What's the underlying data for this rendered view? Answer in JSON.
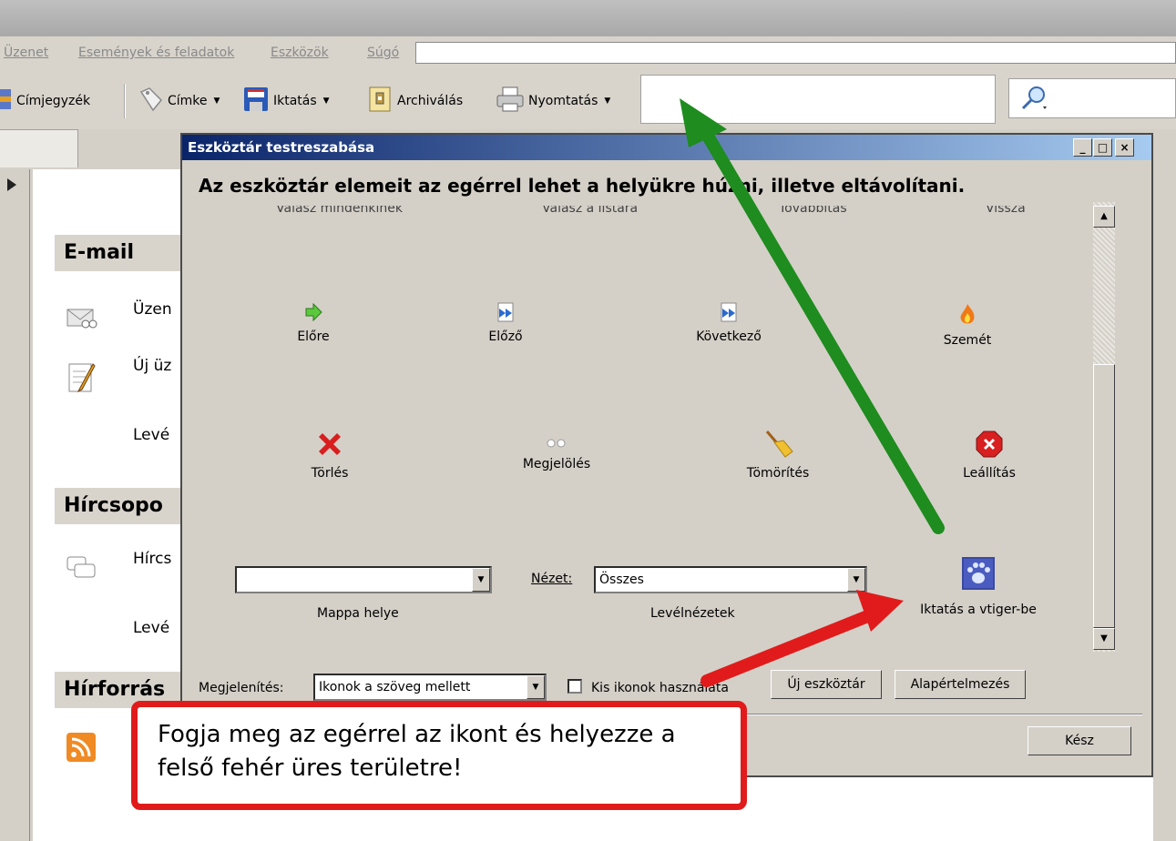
{
  "menubar": {
    "items": [
      "Üzenet",
      "Események és feladatok",
      "Eszközök",
      "Súgó"
    ]
  },
  "toolbar": {
    "buttons": [
      {
        "label": "Címjegyzék",
        "icon": "address-book-icon"
      },
      {
        "label": "Címke",
        "icon": "tag-icon",
        "dropdown": true
      },
      {
        "label": "Iktatás",
        "icon": "save-disk-icon",
        "dropdown": true
      },
      {
        "label": "Archiválás",
        "icon": "archive-icon"
      },
      {
        "label": "Nyomtatás",
        "icon": "printer-icon",
        "dropdown": true
      }
    ],
    "search_icon": "magnifier-icon"
  },
  "sidebar": {
    "sections": [
      {
        "title": "E-mail",
        "rows": [
          "Üzen",
          "Új üz",
          "Levé"
        ]
      },
      {
        "title": "Hírcsopo",
        "rows": [
          "Hírcs",
          "Levé"
        ]
      },
      {
        "title": "Hírforrás",
        "rows": []
      }
    ]
  },
  "dialog": {
    "title": "Eszköztár testreszabása",
    "window_buttons": [
      "_",
      "□",
      "×"
    ],
    "heading": "Az eszköztár elemeit az egérrel lehet a helyükre húzni, illetve eltávolítani.",
    "cut_labels": [
      "Válasz mindenkinek",
      "Válasz a listára",
      "Továbbítás",
      "Vissza"
    ],
    "row1": [
      {
        "label": "Előre",
        "icon": "forward-arrow-icon"
      },
      {
        "label": "Előző",
        "icon": "previous-icon"
      },
      {
        "label": "Következő",
        "icon": "next-icon"
      },
      {
        "label": "Szemét",
        "icon": "junk-flame-icon"
      }
    ],
    "row2": [
      {
        "label": "Törlés",
        "icon": "delete-x-icon"
      },
      {
        "label": "Megjelölés",
        "icon": "mark-icon"
      },
      {
        "label": "Tömörítés",
        "icon": "compact-broom-icon"
      },
      {
        "label": "Leállítás",
        "icon": "stop-icon"
      }
    ],
    "folder_location_label": "Mappa helye",
    "view_label": "Nézet:",
    "view_value": "Összes",
    "view_caption": "Levélnézetek",
    "vtiger_label": "Iktatás a vtiger-be",
    "display_label": "Megjelenítés:",
    "display_value": "Ikonok a szöveg mellett",
    "small_icons_label": "Kis ikonok használata",
    "new_toolbar_button": "Új eszköztár",
    "default_button": "Alapértelmezés",
    "done_button": "Kész"
  },
  "callout": {
    "line1": "Fogja meg az egérrel az ikont és helyezze a",
    "line2": "felső fehér üres területre!"
  },
  "colors": {
    "callout_border": "#e11b1b",
    "green_arrow": "#1e8c1e",
    "red_arrow": "#e11b1b",
    "dialog_title": "#0a246a"
  }
}
